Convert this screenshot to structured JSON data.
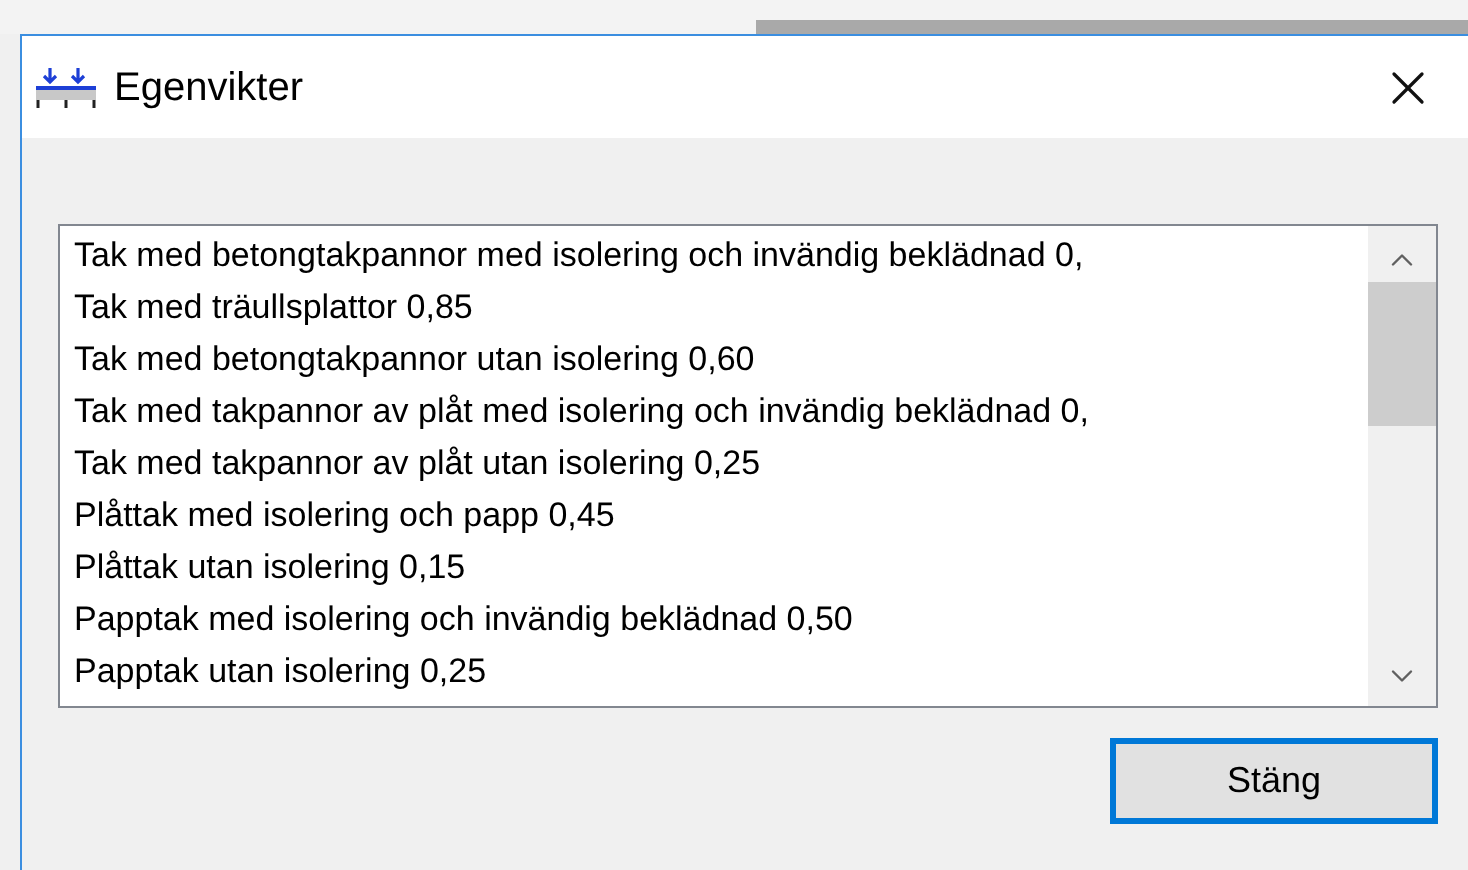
{
  "window": {
    "title": "Egenvikter"
  },
  "list": {
    "items": [
      {
        "label": "Tak med betongtakpannor med isolering och invändig beklädnad 0,"
      },
      {
        "label": "Tak med träullsplattor 0,85"
      },
      {
        "label": "Tak med betongtakpannor utan isolering 0,60"
      },
      {
        "label": "Tak med takpannor av plåt med isolering och invändig beklädnad 0,"
      },
      {
        "label": "Tak med takpannor av plåt utan isolering 0,25"
      },
      {
        "label": "Plåttak med isolering och papp 0,45"
      },
      {
        "label": "Plåttak utan isolering 0,15"
      },
      {
        "label": "Papptak med isolering och invändig beklädnad 0,50"
      },
      {
        "label": "Papptak utan isolering 0,25"
      }
    ]
  },
  "buttons": [
    {
      "label": "Stäng"
    }
  ]
}
